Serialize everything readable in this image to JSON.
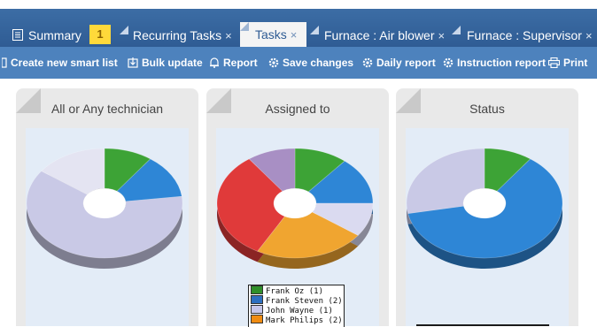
{
  "tabs": [
    {
      "label": "Summary",
      "icon": "document-icon",
      "closable": false,
      "active": false
    },
    {
      "label": "Recurring Tasks",
      "closable": true,
      "active": false
    },
    {
      "label": "Tasks",
      "closable": true,
      "active": true
    },
    {
      "label": "Furnace : Air blower",
      "closable": true,
      "active": false
    },
    {
      "label": "Furnace : Supervisor",
      "closable": true,
      "active": false
    }
  ],
  "badge": "1",
  "close_glyph": "×",
  "toolbar": [
    {
      "label": "Create new smart list",
      "icon": "list-icon"
    },
    {
      "label": "Bulk update",
      "icon": "bulk-update-icon"
    },
    {
      "label": "Report",
      "icon": "bell-icon"
    },
    {
      "label": "Save changes",
      "icon": "gear-icon"
    },
    {
      "label": "Daily report",
      "icon": "gear-icon"
    },
    {
      "label": "Instruction report",
      "icon": "gear-icon"
    },
    {
      "label": "Print",
      "icon": "printer-icon"
    }
  ],
  "panels": [
    {
      "title": "All or Any technician"
    },
    {
      "title": "Assigned to"
    },
    {
      "title": "Status"
    }
  ],
  "chart_data": [
    {
      "type": "pie",
      "title": "All or Any technician",
      "series": [
        {
          "values": [
            10,
            13,
            62,
            15
          ]
        }
      ],
      "colors": [
        "#3da336",
        "#2e86d6",
        "#c9c9e6",
        "#e4e4f2"
      ]
    },
    {
      "type": "pie",
      "title": "Assigned to",
      "categories": [
        "Frank  Oz (1)",
        "Frank Steven (2)",
        "John Wayne (1)",
        "Mark Philips (2)"
      ],
      "series": [
        {
          "values": [
            11,
            14,
            10,
            23,
            32,
            10
          ]
        }
      ],
      "colors": [
        "#3da336",
        "#2e86d6",
        "#dadaf0",
        "#f0a530",
        "#e03a3a",
        "#a88fc4"
      ],
      "legend": [
        {
          "label": "Frank  Oz (1)",
          "color": "#2f8f2a"
        },
        {
          "label": "Frank Steven (2)",
          "color": "#2d6fc0"
        },
        {
          "label": "John Wayne (1)",
          "color": "#c6c6ea"
        },
        {
          "label": "Mark Philips (2)",
          "color": "#f08c12"
        }
      ]
    },
    {
      "type": "pie",
      "title": "Status",
      "series": [
        {
          "values": [
            10,
            62,
            28
          ]
        }
      ],
      "colors": [
        "#3da336",
        "#2e86d6",
        "#c9c9e6"
      ]
    }
  ]
}
